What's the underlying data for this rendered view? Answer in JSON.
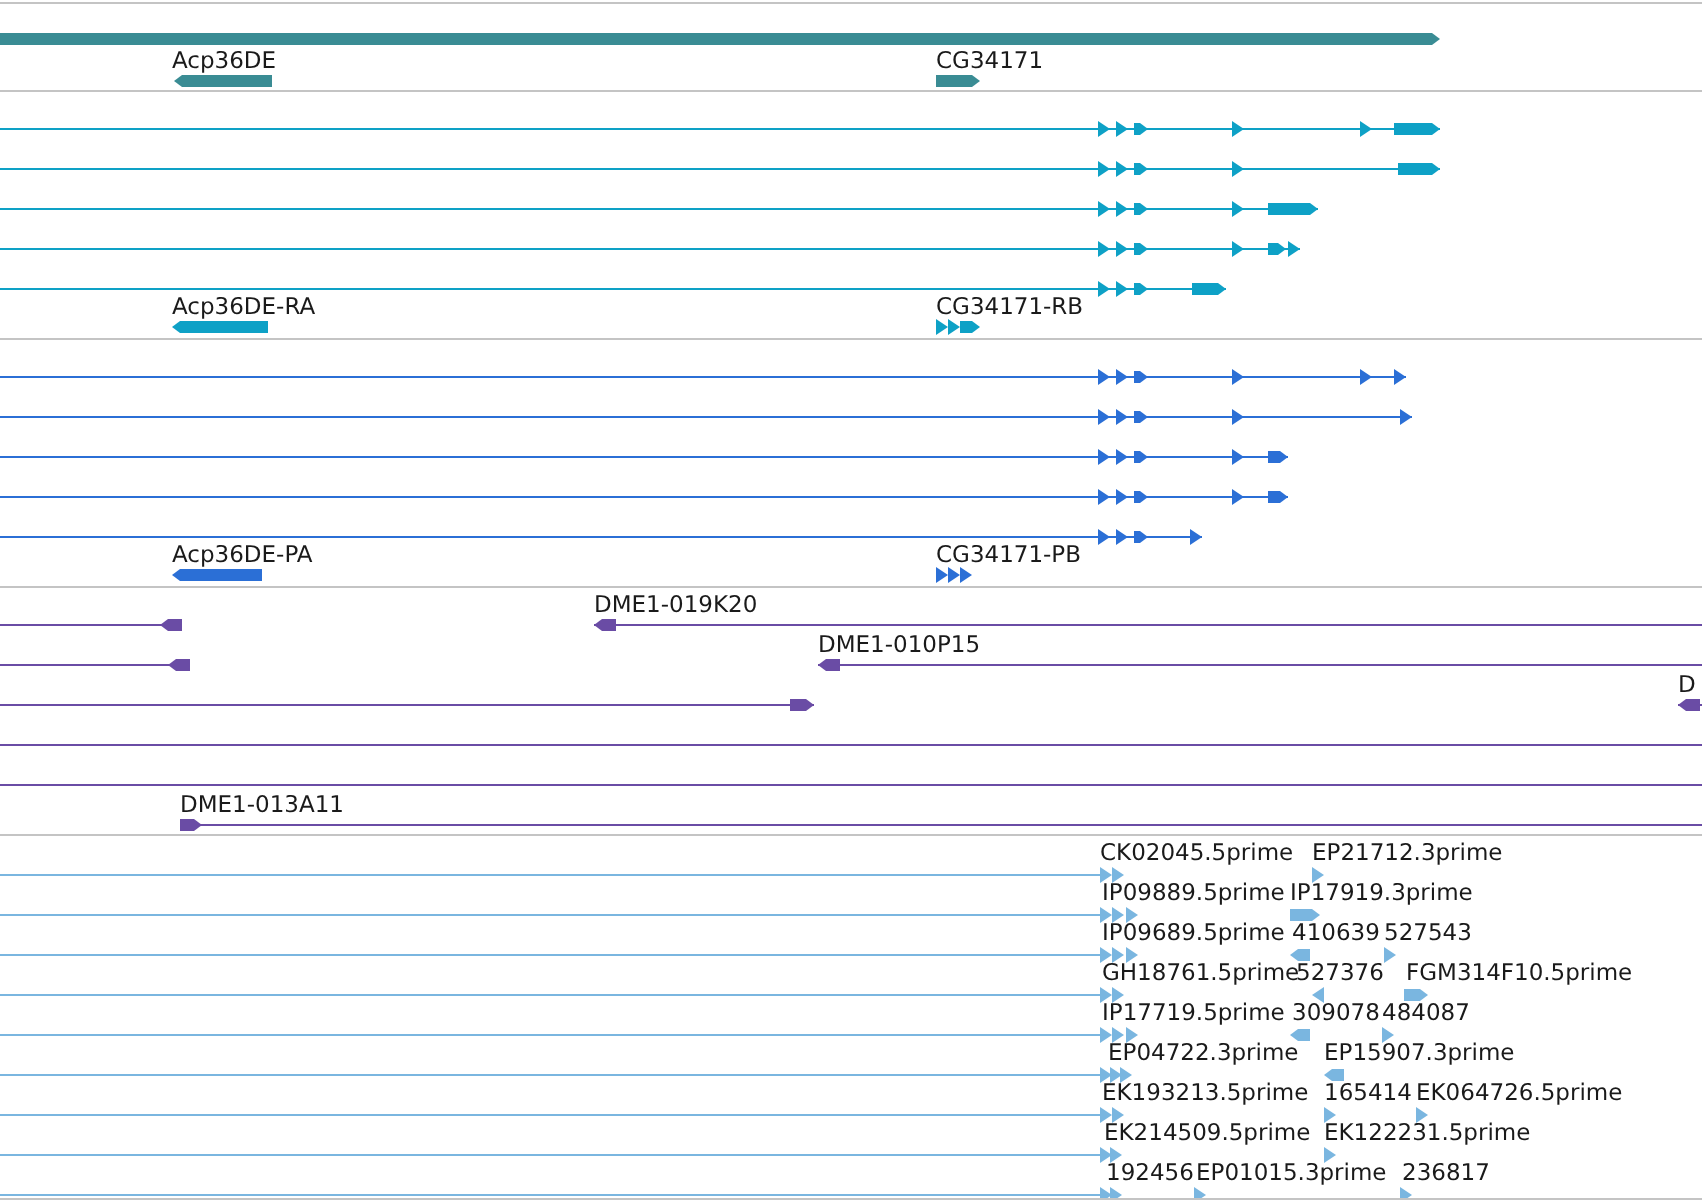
{
  "tracks": [
    {
      "kind": "gene",
      "features": [
        {
          "label": "Acp36DE",
          "reverse": true
        },
        {
          "label": "CG34171",
          "reverse": false
        }
      ]
    },
    {
      "kind": "transcript",
      "features": [
        {
          "label": "Acp36DE-RA",
          "reverse": true
        },
        {
          "label": "CG34171-RB",
          "reverse": false
        }
      ]
    },
    {
      "kind": "protein",
      "features": [
        {
          "label": "Acp36DE-PA",
          "reverse": true
        },
        {
          "label": "CG34171-PB",
          "reverse": false
        }
      ]
    },
    {
      "kind": "clone",
      "features": [
        {
          "label": "DME1-019K20",
          "reverse": true
        },
        {
          "label": "DME1-010P15",
          "reverse": true
        },
        {
          "label": "D",
          "reverse": true
        },
        {
          "label": "DME1-013A11",
          "reverse": false
        }
      ]
    },
    {
      "kind": "est",
      "features": [
        {
          "label": "CK02045.5prime",
          "reverse": false
        },
        {
          "label": "EP21712.3prime",
          "reverse": false
        },
        {
          "label": "IP09889.5prime",
          "reverse": false
        },
        {
          "label": "IP17919.3prime",
          "reverse": false
        },
        {
          "label": "IP09689.5prime",
          "reverse": false
        },
        {
          "label": "410639",
          "reverse": true
        },
        {
          "label": "527543",
          "reverse": false
        },
        {
          "label": "GH18761.5prime",
          "reverse": false
        },
        {
          "label": "527376",
          "reverse": true
        },
        {
          "label": "FGM314F10.5prime",
          "reverse": false
        },
        {
          "label": "IP17719.5prime",
          "reverse": false
        },
        {
          "label": "309078",
          "reverse": true
        },
        {
          "label": "484087",
          "reverse": false
        },
        {
          "label": "EP04722.3prime",
          "reverse": false
        },
        {
          "label": "EP15907.3prime",
          "reverse": true
        },
        {
          "label": "EK193213.5prime",
          "reverse": false
        },
        {
          "label": "165414",
          "reverse": false
        },
        {
          "label": "EK064726.5prime",
          "reverse": false
        },
        {
          "label": "EK214509.5prime",
          "reverse": false
        },
        {
          "label": "EK122231.5prime",
          "reverse": false
        },
        {
          "label": "192456",
          "reverse": false
        },
        {
          "label": "EP01015.3prime",
          "reverse": false
        },
        {
          "label": "236817",
          "reverse": false
        }
      ]
    }
  ]
}
